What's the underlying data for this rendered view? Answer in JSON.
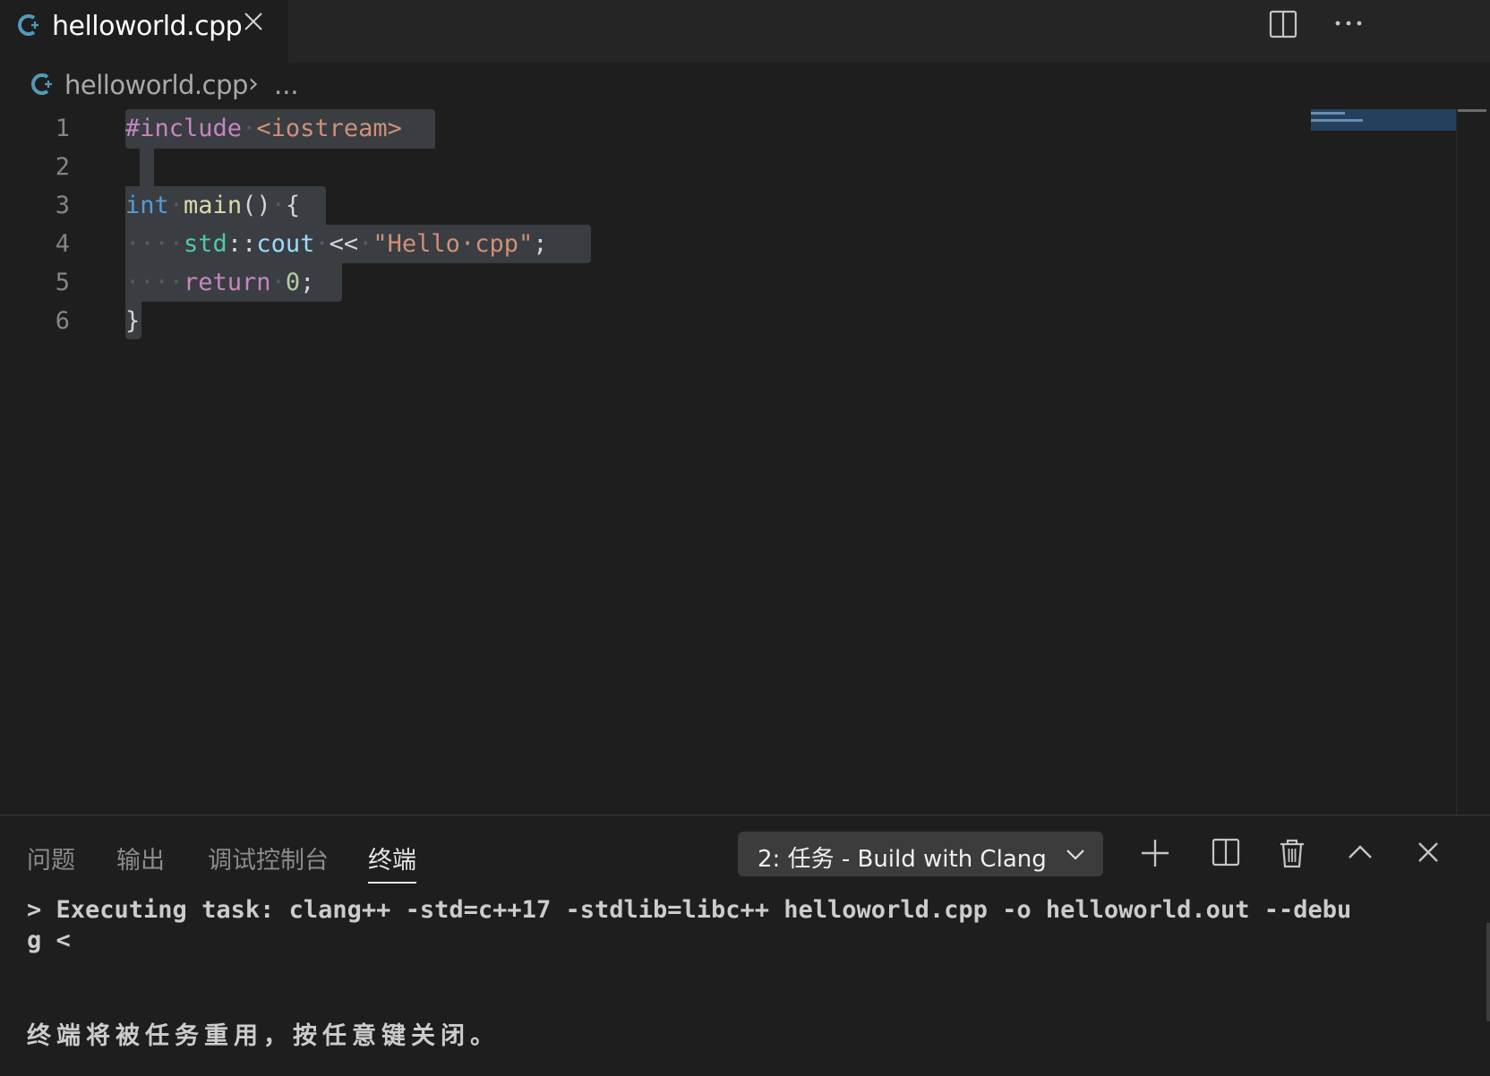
{
  "tab": {
    "file_icon": "cpp-file-icon",
    "title": "helloworld.cpp",
    "close_glyph": "×"
  },
  "breadcrumb": {
    "file": "helloworld.cpp",
    "separator": "›",
    "more": "..."
  },
  "editor": {
    "lines": [
      {
        "number": "1"
      },
      {
        "number": "2"
      },
      {
        "number": "3"
      },
      {
        "number": "4"
      },
      {
        "number": "5"
      },
      {
        "number": "6"
      }
    ],
    "tokens": {
      "l1_include": "#include",
      "l1_header": "<iostream>",
      "l3_int": "int",
      "l3_main": "main",
      "l3_rest": "()",
      "l3_brace": "{",
      "l4_std": "std",
      "l4_colons": "::",
      "l4_cout": "cout",
      "l4_op": "<<",
      "l4_str": "\"Hello·cpp\"",
      "l4_semi": ";",
      "l5_return": "return",
      "l5_zero": "0",
      "l5_semi": ";",
      "l6_brace": "}"
    },
    "whitespace_dot": "·",
    "indent_dots": "····"
  },
  "panel": {
    "tabs": [
      {
        "label": "问题"
      },
      {
        "label": "输出"
      },
      {
        "label": "调试控制台"
      },
      {
        "label": "终端"
      }
    ],
    "terminal_select": "2: 任务 - Build with Clang",
    "terminal_output": [
      "> Executing task: clang++ -std=c++17 -stdlib=libc++ helloworld.cpp -o helloworld.out --debu",
      "g <"
    ],
    "terminal_message": "终端将被任务重用，按任意键关闭。"
  }
}
